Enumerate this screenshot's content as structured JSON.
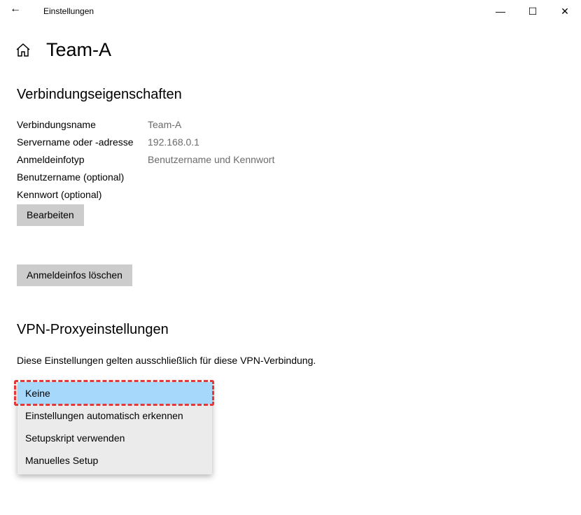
{
  "window": {
    "title": "Einstellungen"
  },
  "page": {
    "title": "Team-A"
  },
  "properties": {
    "heading": "Verbindungseigenschaften",
    "rows": [
      {
        "label": "Verbindungsname",
        "value": "Team-A"
      },
      {
        "label": "Servername oder -adresse",
        "value": "192.168.0.1"
      },
      {
        "label": "Anmeldeinfotyp",
        "value": "Benutzername und Kennwort"
      },
      {
        "label": "Benutzername (optional)",
        "value": ""
      },
      {
        "label": "Kennwort (optional)",
        "value": ""
      }
    ],
    "edit_button": "Bearbeiten",
    "clear_button": "Anmeldeinfos löschen"
  },
  "proxy": {
    "heading": "VPN-Proxyeinstellungen",
    "description": "Diese Einstellungen gelten ausschließlich für diese VPN-Verbindung.",
    "options": [
      "Keine",
      "Einstellungen automatisch erkennen",
      "Setupskript verwenden",
      "Manuelles Setup"
    ],
    "selected": "Keine"
  }
}
